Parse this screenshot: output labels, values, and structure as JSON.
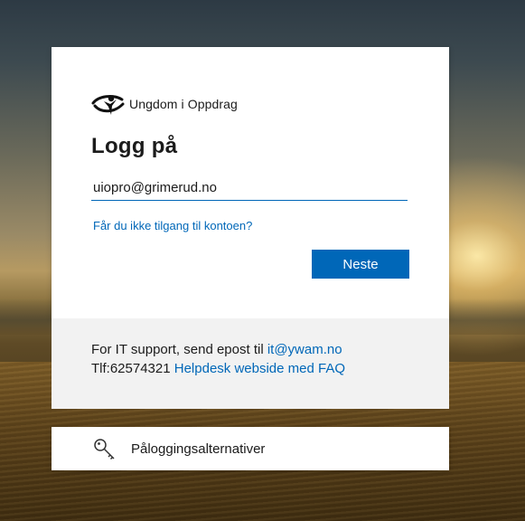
{
  "org": {
    "name": "Ungdom i Oppdrag",
    "logo_icon": "ungdom-i-oppdrag-logo-icon"
  },
  "signin": {
    "title": "Logg på",
    "email_value": "uiopro@grimerud.no",
    "help_link": "Får du ikke tilgang til kontoen?",
    "next_button": "Neste"
  },
  "info": {
    "line1_text": "For IT support, send epost til ",
    "line1_link": "it@ywam.no",
    "line2_text": "Tlf:62574321 ",
    "line2_link": "Helpdesk webside med FAQ"
  },
  "options": {
    "icon": "key-icon",
    "label": "Påloggingsalternativer"
  },
  "colors": {
    "accent": "#0067b8",
    "panel_bg": "#f2f2f2",
    "text": "#1b1b1b"
  }
}
